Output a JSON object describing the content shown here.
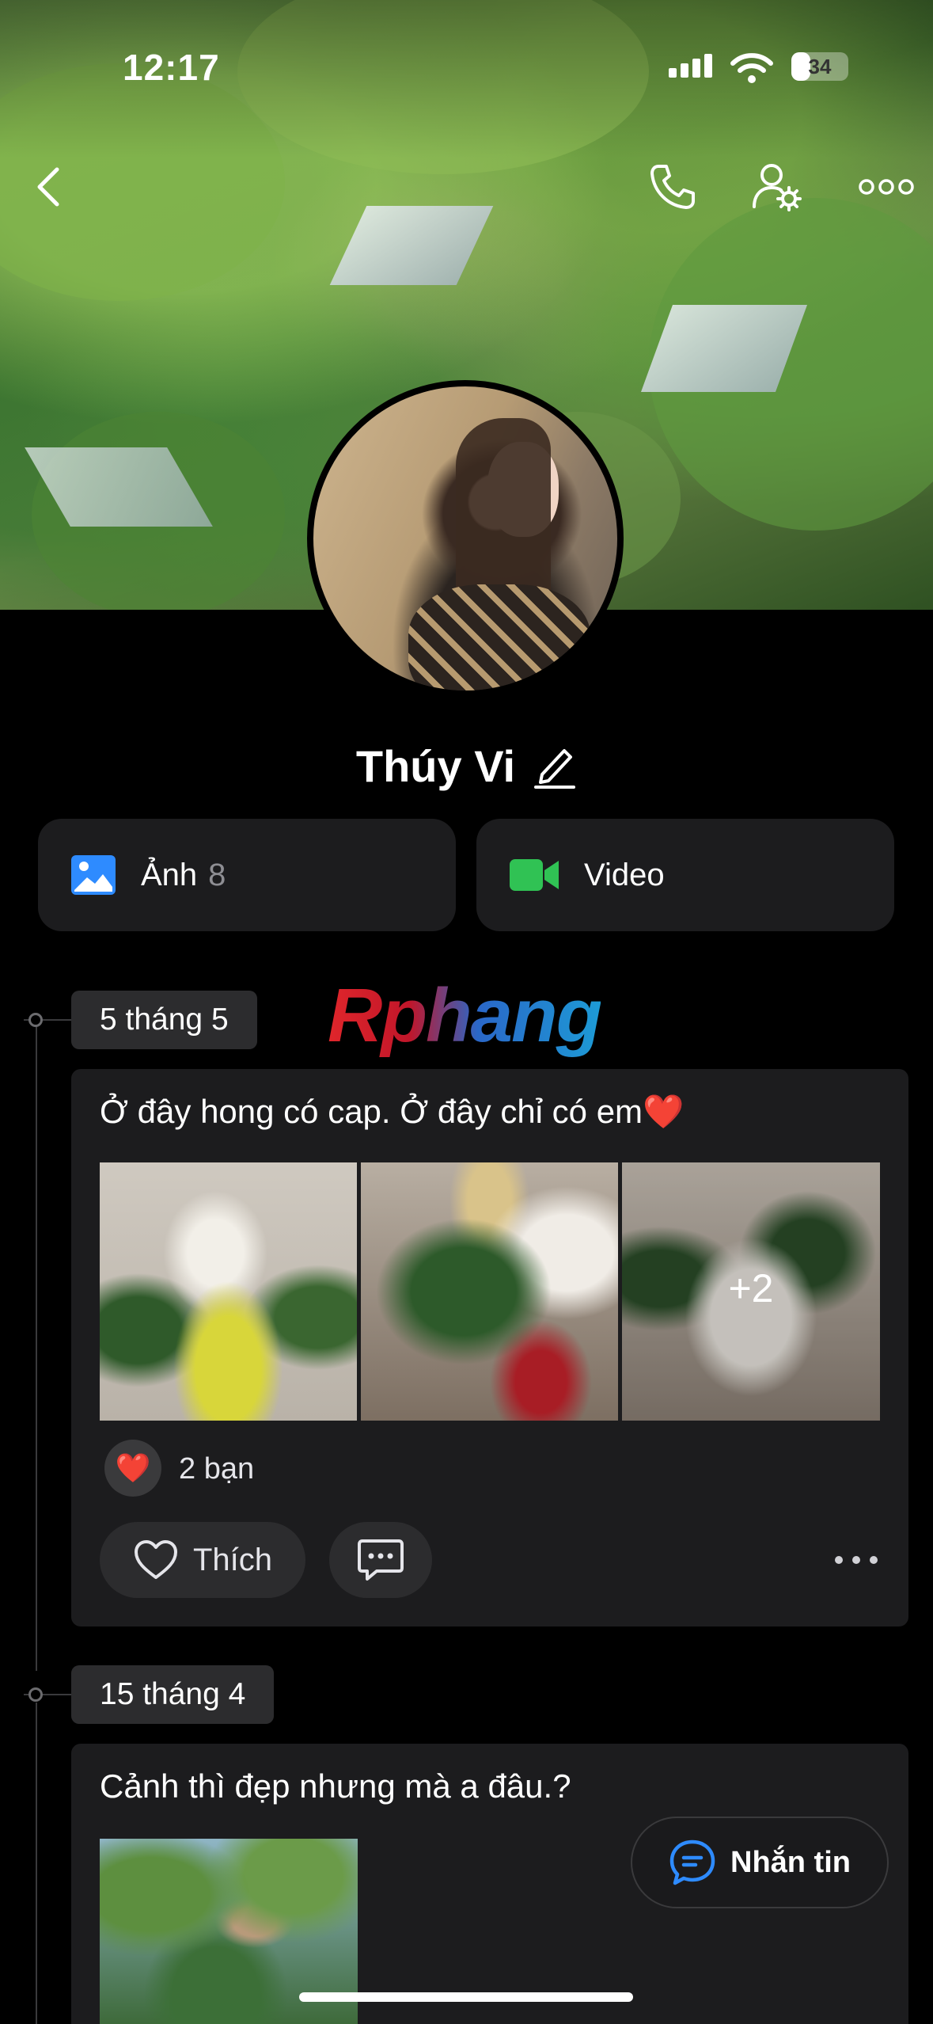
{
  "status_bar": {
    "time": "12:17",
    "battery_level": "34",
    "battery_fraction": 0.34
  },
  "profile": {
    "name": "Thúy Vi"
  },
  "media": {
    "photos": {
      "label": "Ảnh",
      "count": "8"
    },
    "videos": {
      "label": "Video"
    }
  },
  "watermark": "Rphang",
  "posts": [
    {
      "date": "5 tháng 5",
      "text": "Ở đây hong có cap. Ở đây chỉ có em❤️",
      "more_photos": "+2",
      "reactions": {
        "emoji": "❤️",
        "summary": "2 bạn"
      },
      "like_label": "Thích"
    },
    {
      "date": "15 tháng 4",
      "text": "Cảnh thì đẹp nhưng mà a đâu.?"
    }
  ],
  "message_button": {
    "label": "Nhắn tin"
  },
  "colors": {
    "accent_blue": "#2e8bff",
    "video_green": "#30c254",
    "background": "#000000",
    "card": "#1c1c1e"
  }
}
